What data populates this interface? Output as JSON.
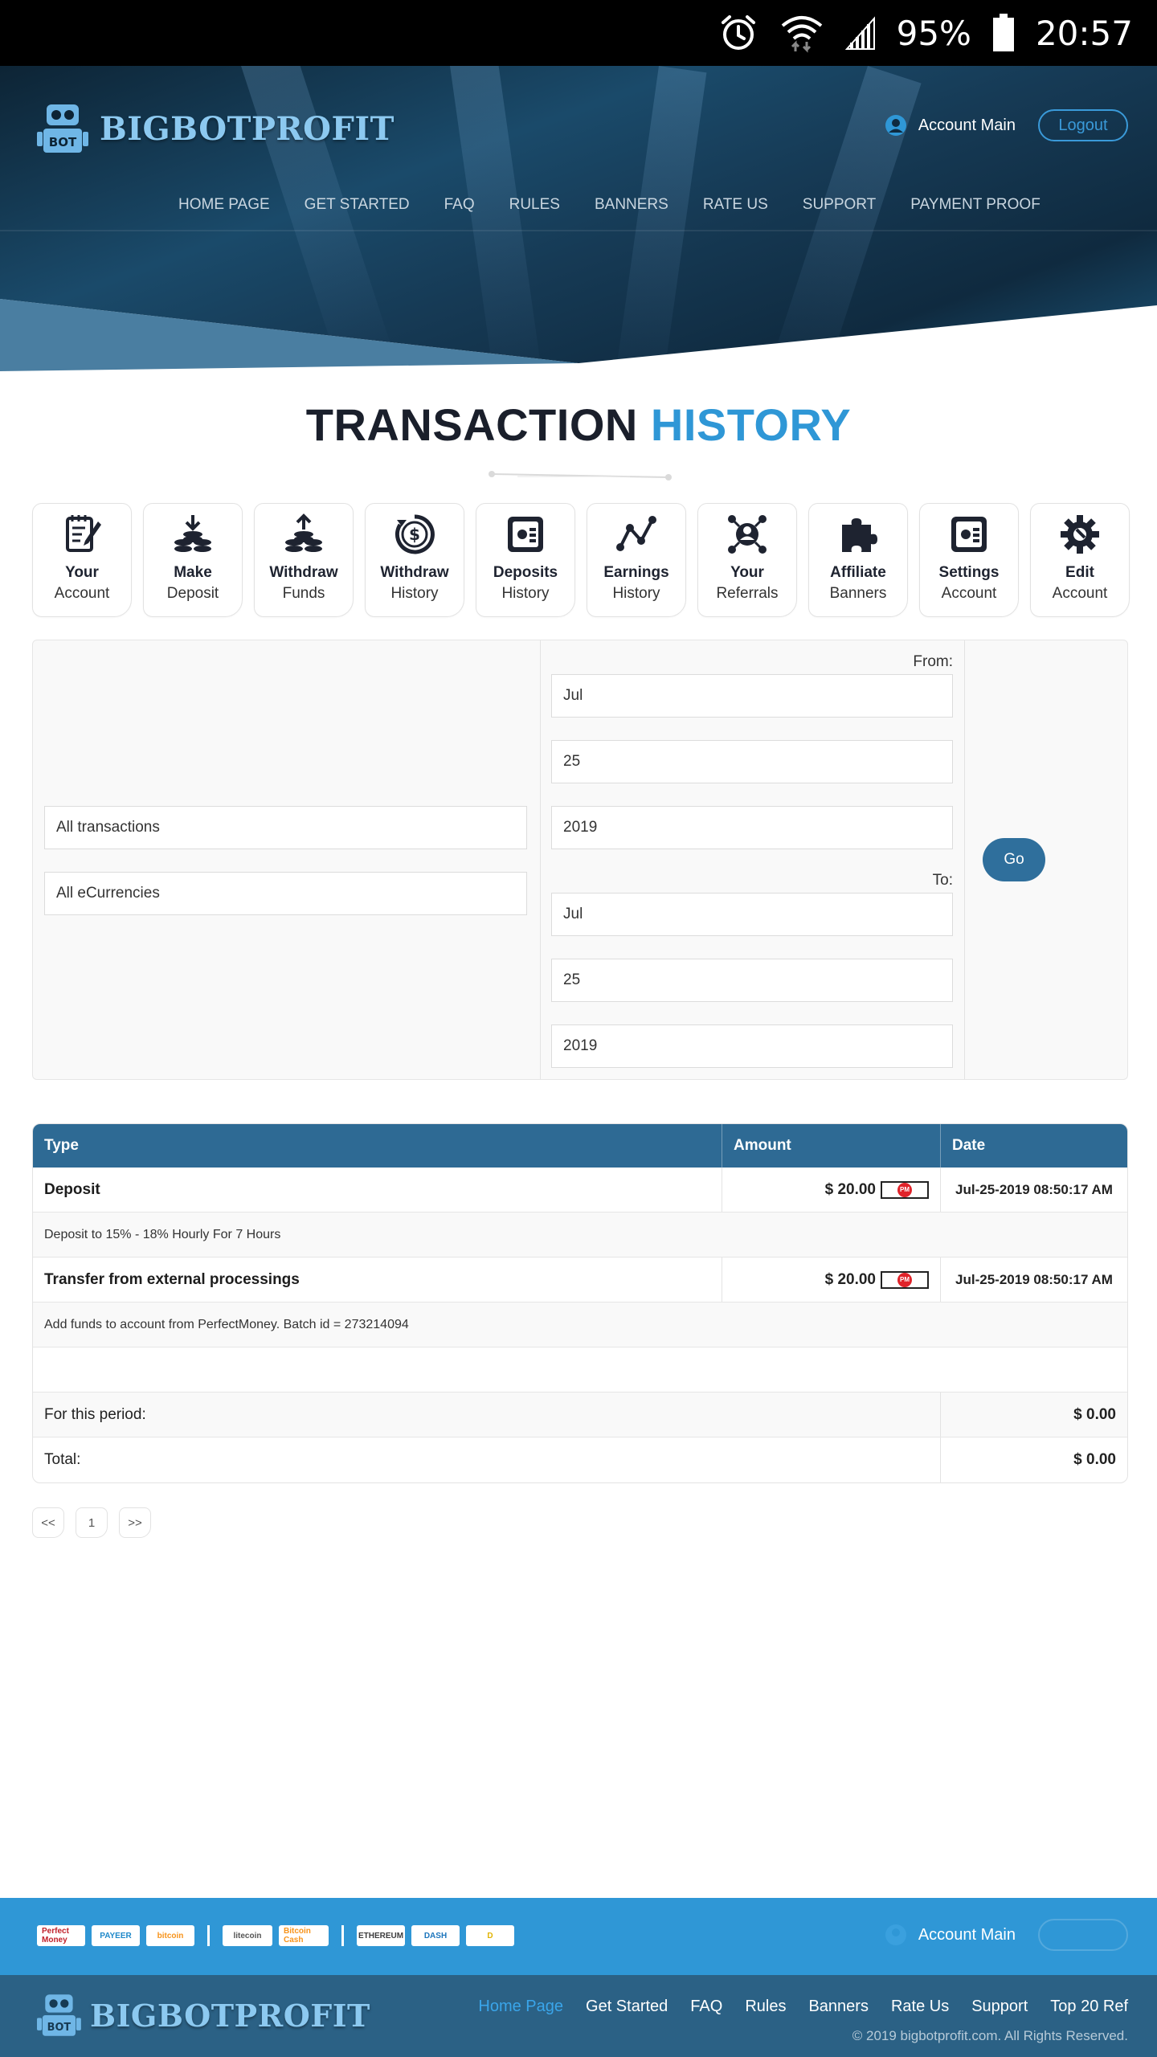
{
  "status_bar": {
    "battery": "95%",
    "time": "20:57"
  },
  "header": {
    "logo_text": "BIGBOTPROFIT",
    "logo_badge": "BOT",
    "account_link": "Account Main",
    "logout_label": "Logout",
    "nav": [
      "HOME PAGE",
      "GET STARTED",
      "FAQ",
      "RULES",
      "BANNERS",
      "RATE US",
      "SUPPORT",
      "PAYMENT PROOF"
    ]
  },
  "page_title": {
    "part1": "TRANSACTION",
    "part2": "HISTORY"
  },
  "tiles": [
    {
      "l1": "Your",
      "l2": "Account",
      "icon": "notepad-pen-icon"
    },
    {
      "l1": "Make",
      "l2": "Deposit",
      "icon": "coins-down-icon"
    },
    {
      "l1": "Withdraw",
      "l2": "Funds",
      "icon": "coins-up-icon"
    },
    {
      "l1": "Withdraw",
      "l2": "History",
      "icon": "dollar-circle-icon"
    },
    {
      "l1": "Deposits",
      "l2": "History",
      "icon": "panel-icon"
    },
    {
      "l1": "Earnings",
      "l2": "History",
      "icon": "line-graph-icon"
    },
    {
      "l1": "Your",
      "l2": "Referrals",
      "icon": "network-user-icon"
    },
    {
      "l1": "Affiliate",
      "l2": "Banners",
      "icon": "puzzle-icon"
    },
    {
      "l1": "Settings",
      "l2": "Account",
      "icon": "panel-icon"
    },
    {
      "l1": "Edit",
      "l2": "Account",
      "icon": "gear-icon"
    }
  ],
  "filter": {
    "type_value": "All transactions",
    "currency_value": "All eCurrencies",
    "from_label": "From:",
    "to_label": "To:",
    "from": {
      "month": "Jul",
      "day": "25",
      "year": "2019"
    },
    "to": {
      "month": "Jul",
      "day": "25",
      "year": "2019"
    },
    "go_label": "Go"
  },
  "table": {
    "headers": {
      "type": "Type",
      "amount": "Amount",
      "date": "Date"
    },
    "rows": [
      {
        "type": "Deposit",
        "amount": "$ 20.00",
        "processor": "PM",
        "date": "Jul-25-2019 08:50:17 AM",
        "desc": "Deposit to 15% - 18% Hourly For 7 Hours"
      },
      {
        "type": "Transfer from external processings",
        "amount": "$ 20.00",
        "processor": "PM",
        "date": "Jul-25-2019 08:50:17 AM",
        "desc": "Add funds to account from PerfectMoney. Batch id = 273214094"
      }
    ],
    "period_label": "For this period:",
    "period_value": "$ 0.00",
    "total_label": "Total:",
    "total_value": "$ 0.00"
  },
  "pager": {
    "prev": "<<",
    "page": "1",
    "next": ">>"
  },
  "footer": {
    "pay_logos": [
      "Perfect Money",
      "PAYEER",
      "bitcoin",
      "litecoin",
      "Bitcoin Cash",
      "ETHEREUM",
      "DASH",
      "D"
    ],
    "account_link": "Account Main",
    "logo_text": "BIGBOTPROFIT",
    "logo_badge": "BOT",
    "nav": [
      "Home Page",
      "Get Started",
      "FAQ",
      "Rules",
      "Banners",
      "Rate Us",
      "Support",
      "Top 20 Ref"
    ],
    "copyright": "© 2019 bigbotprofit.com. All Rights Reserved."
  },
  "colors": {
    "accent": "#2f97d6",
    "table_head": "#2e6a94",
    "footer_dark": "#2b6185"
  }
}
